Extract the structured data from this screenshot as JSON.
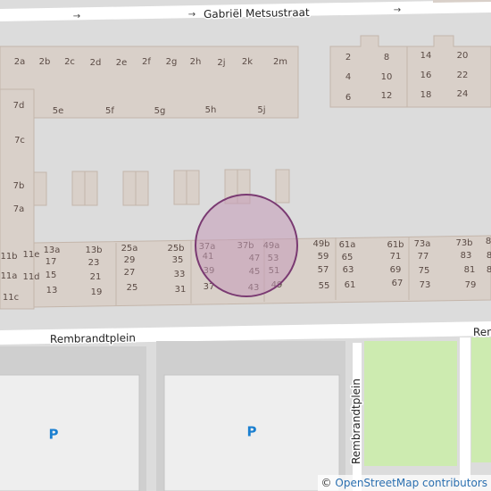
{
  "map": {
    "streets": [
      {
        "id": "gabriel-metsustraat",
        "name": "Gabriël Metsustraat"
      },
      {
        "id": "rembrandtplein-h",
        "name": "Rembrandtplein"
      },
      {
        "id": "rembrandtplein-v",
        "name": "Rembrandtplein"
      },
      {
        "id": "rembrandtplein-right",
        "name": "Rem"
      }
    ],
    "parking_symbol": "P",
    "oneway_symbol": "→",
    "colors": {
      "background": "#dcdcdc",
      "road": "#ffffff",
      "building": "#d9d0c9",
      "building_outline": "#c4b6ab",
      "grass": "#cdebb0",
      "highlight_fill": "#c49ab8",
      "highlight_stroke": "#7a3a72"
    },
    "house_numbers": [
      "2a",
      "2b",
      "2c",
      "2d",
      "2e",
      "2f",
      "2g",
      "2h",
      "2j",
      "2k",
      "2m",
      "7d",
      "5e",
      "5f",
      "5g",
      "5h",
      "5j",
      "7c",
      "7b",
      "7a",
      "11b",
      "11e",
      "11a",
      "11d",
      "11c",
      "13a",
      "17",
      "15",
      "13",
      "13b",
      "23",
      "21",
      "19",
      "25a",
      "29",
      "27",
      "25",
      "25b",
      "35",
      "33",
      "31",
      "37a",
      "41",
      "39",
      "37",
      "37b",
      "47",
      "45",
      "43",
      "49a",
      "53",
      "51",
      "49",
      "49b",
      "59",
      "57",
      "55",
      "61a",
      "65",
      "63",
      "61",
      "61b",
      "71",
      "69",
      "67",
      "73a",
      "77",
      "75",
      "73",
      "73b",
      "83",
      "81",
      "79",
      "8",
      "8",
      "8",
      "2",
      "4",
      "6",
      "8",
      "10",
      "12",
      "14",
      "16",
      "18",
      "20",
      "22",
      "24"
    ]
  },
  "attribution": {
    "copyright": "©",
    "text": "OpenStreetMap contributors"
  }
}
